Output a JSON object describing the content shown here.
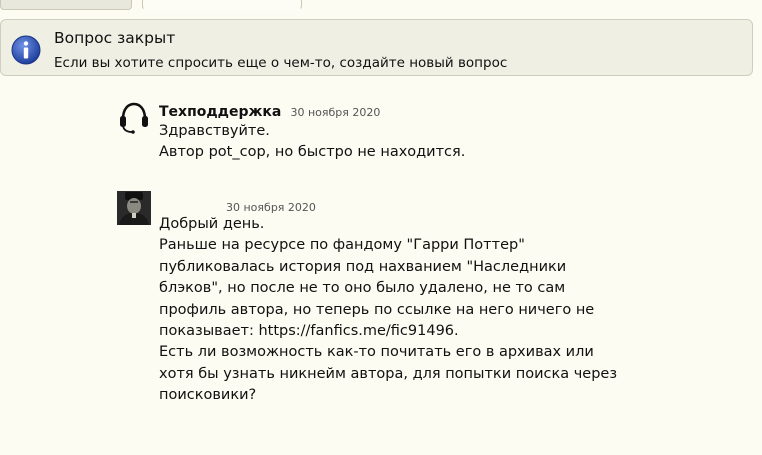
{
  "notice": {
    "title": "Вопрос закрыт",
    "text": "Если вы хотите спросить еще о чем-то, создайте новый вопрос"
  },
  "messages": [
    {
      "author": "Техподдержка",
      "date": "30 ноября 2020",
      "avatar_icon": "headset-icon",
      "lines": [
        "Здравствуйте.",
        "Автор pot_cop, но быстро не находится."
      ]
    },
    {
      "author": "",
      "date": "30 ноября 2020",
      "avatar_icon": "user-photo",
      "lines": [
        "Добрый день.",
        "Раньше на ресурсе по фандому \"Гарри Поттер\"",
        "публиковалась история под нахванием \"Наследники",
        "блэков\", но после не то оно было удалено, не то сам",
        "профиль автора, но теперь по ссылке на него ничего не",
        "показывает: https://fanfics.me/fic91496.",
        "Есть ли возможность как-то почитать его в архивах или",
        "хотя бы узнать никнейм автора, для попытки поиска через",
        "поисковики?"
      ]
    }
  ],
  "colors": {
    "background": "#fcfcf3",
    "notice_bg": "#efefe4",
    "info_icon": "#2f55b8"
  }
}
